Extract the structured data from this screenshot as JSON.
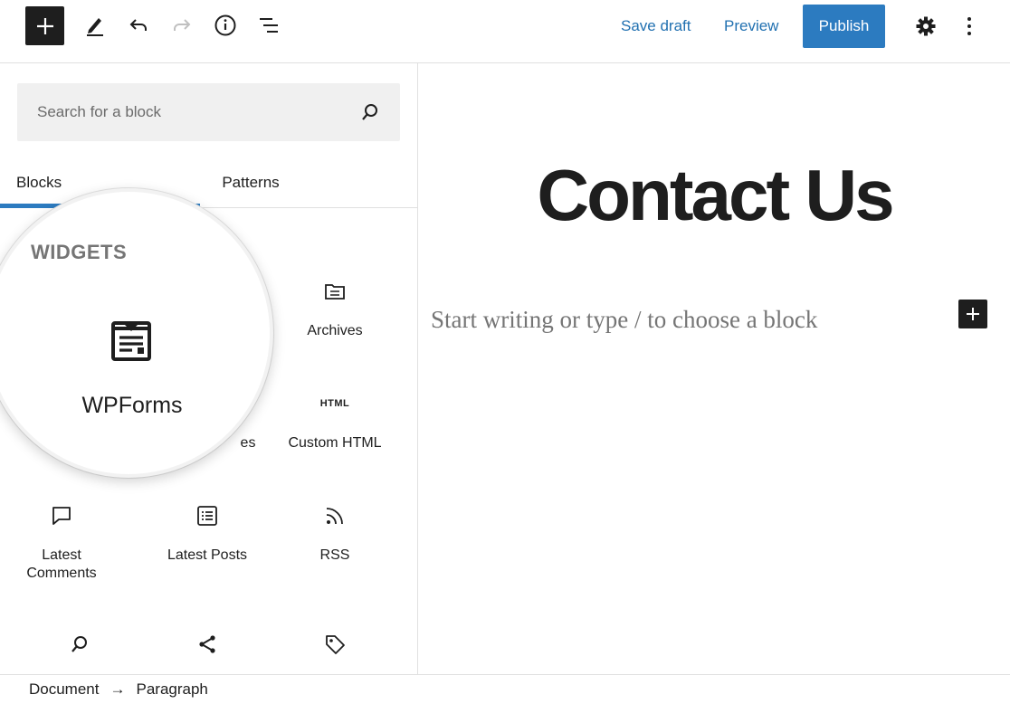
{
  "toolbar": {
    "save_draft": "Save draft",
    "preview": "Preview",
    "publish": "Publish",
    "accent": "#2c7bc0"
  },
  "sidebar": {
    "search": {
      "placeholder": "Search for a block"
    },
    "tabs": [
      {
        "label": "Blocks",
        "active": true
      },
      {
        "label": "Patterns",
        "active": false
      }
    ],
    "section_heading": "WIDGETS",
    "blocks": [
      {
        "label": "WPForms",
        "icon": "wpforms-icon"
      },
      {
        "label": "Archives",
        "icon": "archive-folder-icon"
      },
      {
        "label": "es",
        "icon": "categories-icon"
      },
      {
        "label": "Custom HTML",
        "icon": "html-icon",
        "icon_text": "HTML"
      },
      {
        "label": "Latest Comments",
        "icon": "comment-icon"
      },
      {
        "label": "Latest Posts",
        "icon": "post-list-icon"
      },
      {
        "label": "RSS",
        "icon": "rss-icon"
      },
      {
        "icon": "search-icon"
      },
      {
        "icon": "share-icon"
      },
      {
        "icon": "tag-icon"
      }
    ]
  },
  "canvas": {
    "title": "Contact Us",
    "placeholder": "Start writing or type / to choose a block"
  },
  "footer": {
    "crumbs": [
      "Document",
      "Paragraph"
    ]
  }
}
